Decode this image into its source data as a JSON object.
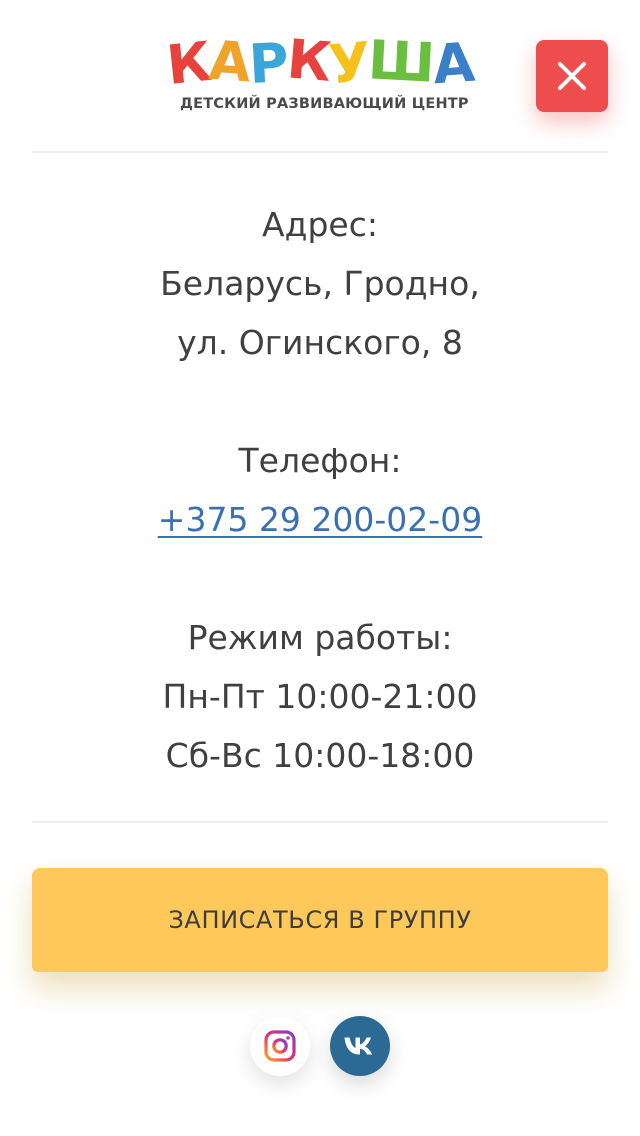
{
  "header": {
    "logo": {
      "letters": [
        {
          "char": "К",
          "color": "#e8423f"
        },
        {
          "char": "А",
          "color": "#f0a22a"
        },
        {
          "char": "Р",
          "color": "#3ba6d9"
        },
        {
          "char": "К",
          "color": "#e8423f"
        },
        {
          "char": "У",
          "color": "#f5c21b"
        },
        {
          "char": "Ш",
          "color": "#6bbf3e"
        },
        {
          "char": "А",
          "color": "#3b7fc9"
        }
      ],
      "tagline": "ДЕТСКИЙ РАЗВИВАЮЩИЙ ЦЕНТР"
    },
    "close_icon": "close-icon",
    "close_color": "#ee4d4d"
  },
  "contact": {
    "address_label": "Адрес:",
    "address_line1": "Беларусь, Гродно,",
    "address_line2": "ул. Огинского, 8",
    "phone_label": "Телефон:",
    "phone": "+375 29 200-02-09",
    "phone_color": "#3a6fb0",
    "hours_label": "Режим работы:",
    "hours_weekdays": "Пн-Пт 10:00-21:00",
    "hours_weekend": "Сб-Вс 10:00-18:00"
  },
  "cta": {
    "label": "ЗАПИСАТЬСЯ В ГРУППУ",
    "color": "#fec85a"
  },
  "social": [
    {
      "name": "instagram",
      "icon": "instagram-icon"
    },
    {
      "name": "vk",
      "icon": "vk-icon",
      "color": "#2c6a96"
    }
  ]
}
